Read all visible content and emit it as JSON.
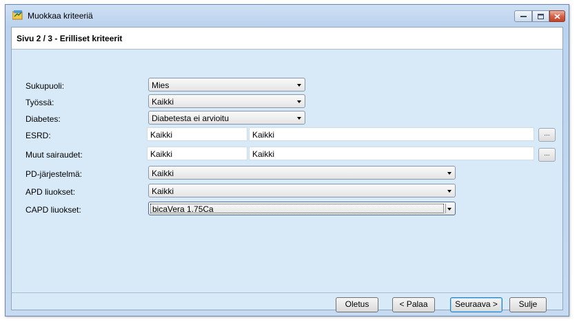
{
  "window": {
    "title": "Muokkaa kriteeriä",
    "controls": {
      "minimize_icon": "minimize-icon",
      "maximize_icon": "maximize-icon",
      "close_icon": "close-icon"
    }
  },
  "page": {
    "title": "Sivu 2 / 3 - Erilliset kriteerit"
  },
  "form": {
    "gender": {
      "label": "Sukupuoli:",
      "value": "Mies"
    },
    "working": {
      "label": "Työssä:",
      "value": "Kaikki"
    },
    "diabetes": {
      "label": "Diabetes:",
      "value": "Diabetesta ei arvioitu"
    },
    "esrd": {
      "label": "ESRD:",
      "code": "Kaikki",
      "text": "Kaikki",
      "browse": "..."
    },
    "other_diseases": {
      "label": "Muut sairaudet:",
      "code": "Kaikki",
      "text": "Kaikki",
      "browse": "..."
    },
    "pd_system": {
      "label": "PD-järjestelmä:",
      "value": "Kaikki"
    },
    "apd_solutions": {
      "label": "APD liuokset:",
      "value": "Kaikki"
    },
    "capd_solutions": {
      "label": "CAPD liuokset:",
      "value": "bicaVera 1.75Ca"
    }
  },
  "buttons": {
    "default": "Oletus",
    "back": "< Palaa",
    "next": "Seuraava >",
    "close": "Sulje"
  }
}
